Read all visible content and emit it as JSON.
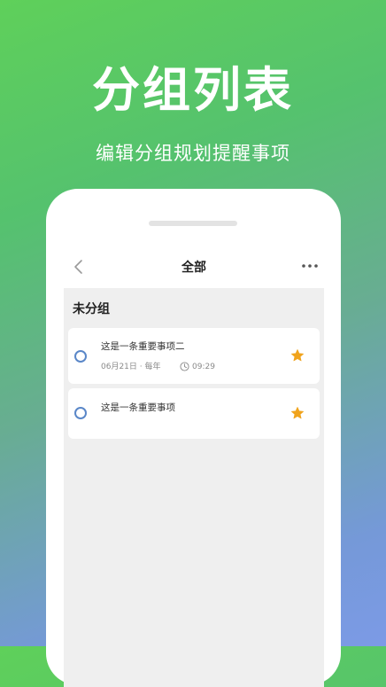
{
  "promo": {
    "title": "分组列表",
    "subtitle": "编辑分组规划提醒事项"
  },
  "header": {
    "back_icon": "chevron-left-icon",
    "title": "全部",
    "more_icon": "more-horizontal-icon"
  },
  "group": {
    "name": "未分组"
  },
  "tasks": [
    {
      "title": "这是一条重要事项二",
      "meta": "06月21日 · 每年",
      "time": "09:29",
      "starred": true
    },
    {
      "title": "这是一条重要事项",
      "starred": true
    }
  ],
  "colors": {
    "star": "#f0a31c",
    "checkbox": "#5a87c8",
    "gradient_start": "#5fd05a",
    "gradient_end": "#7c9ae6"
  }
}
